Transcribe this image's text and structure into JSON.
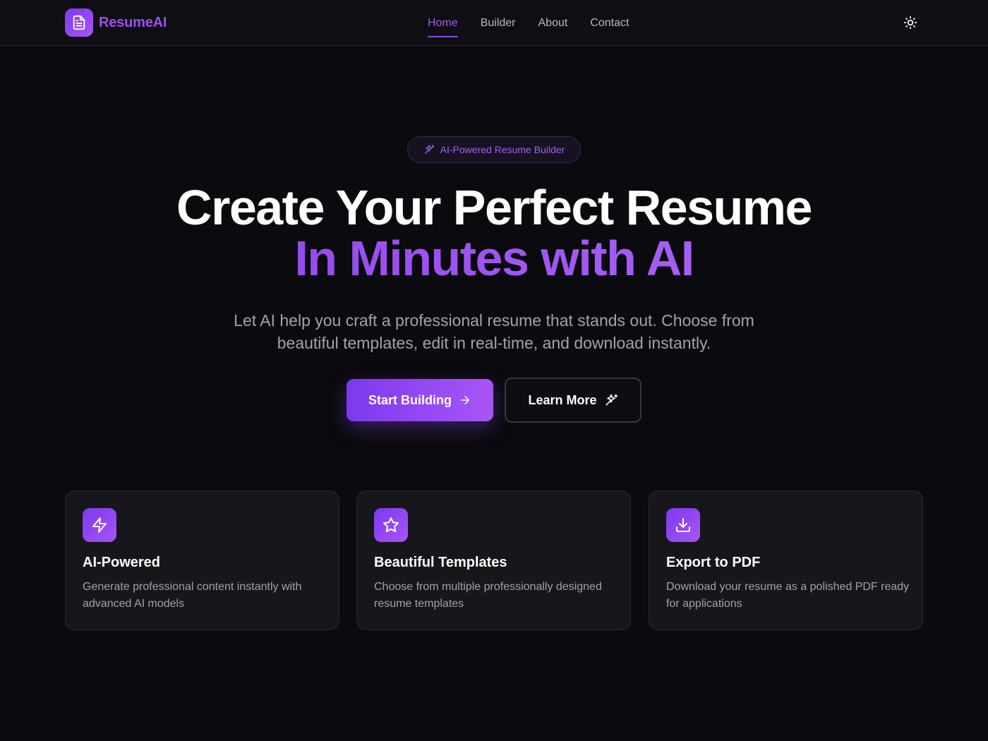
{
  "brand": {
    "name": "ResumeAI",
    "icon": "document-icon",
    "accent": "#8b45ef"
  },
  "nav": {
    "items": [
      {
        "label": "Home",
        "active": true
      },
      {
        "label": "Builder",
        "active": false
      },
      {
        "label": "About",
        "active": false
      },
      {
        "label": "Contact",
        "active": false
      }
    ],
    "theme_toggle_icon": "sun-icon"
  },
  "hero": {
    "badge": "AI-Powered Resume Builder",
    "title_line1": "Create Your Perfect Resume",
    "title_line2": "In Minutes with AI",
    "subtitle": "Let AI help you craft a professional resume that stands out. Choose from beautiful templates, edit in real-time, and download instantly.",
    "primary_button": "Start Building",
    "secondary_button": "Learn More"
  },
  "features": [
    {
      "icon": "lightning-icon",
      "title": "AI-Powered",
      "description": "Generate professional content instantly with advanced AI models"
    },
    {
      "icon": "star-icon",
      "title": "Beautiful Templates",
      "description": "Choose from multiple professionally designed resume templates"
    },
    {
      "icon": "download-icon",
      "title": "Export to PDF",
      "description": "Download your resume as a polished PDF ready for applications"
    }
  ]
}
